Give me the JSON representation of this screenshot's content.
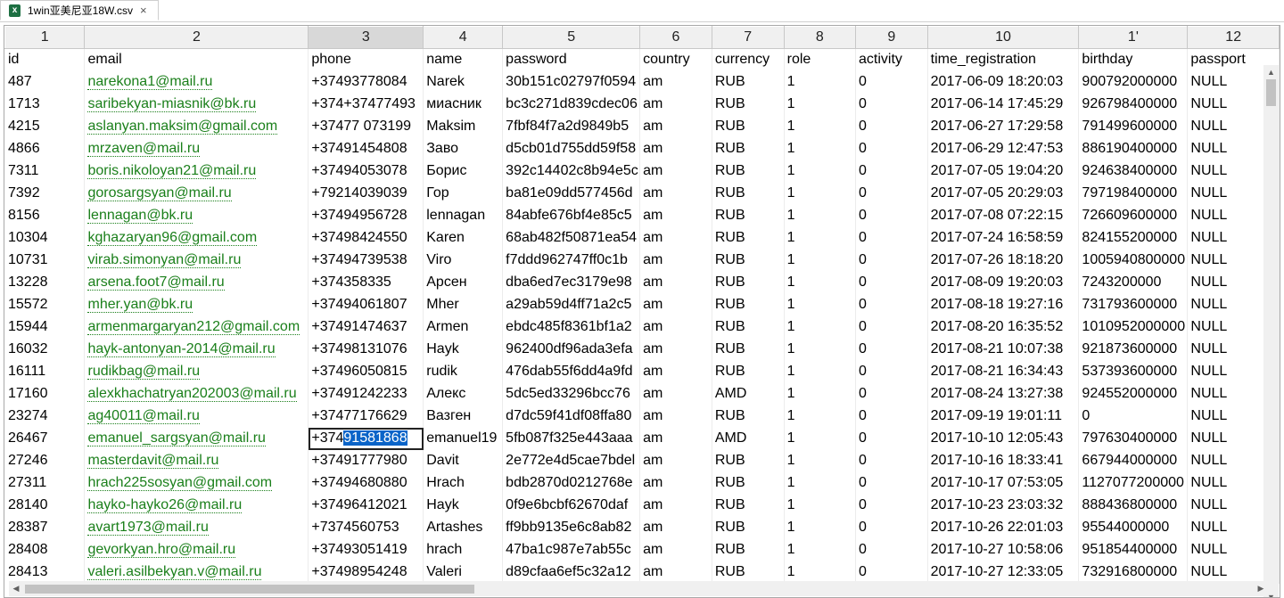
{
  "tab": {
    "title": "1win亚美尼亚18W.csv",
    "icon": "excel-file-icon",
    "close": "×"
  },
  "columns": [
    "1",
    "2",
    "3",
    "4",
    "5",
    "6",
    "7",
    "8",
    "9",
    "10",
    "1'",
    "12"
  ],
  "selected_column": 2,
  "header_row": [
    "id",
    "email",
    "phone",
    "name",
    "password",
    "country",
    "currency",
    "role",
    "activity",
    "time_registration",
    "birthday",
    "passport"
  ],
  "rows": [
    [
      "487",
      "narekona1@mail.ru",
      "+37493778084",
      "Narek",
      "30b151c02797f0594",
      "am",
      "RUB",
      "1",
      "0",
      "2017-06-09 18:20:03",
      "900792000000",
      "NULL"
    ],
    [
      "1713",
      "saribekyan-miasnik@bk.ru",
      "+374+37477493",
      "миасник",
      "bc3c271d839cdec06",
      "am",
      "RUB",
      "1",
      "0",
      "2017-06-14 17:45:29",
      "926798400000",
      "NULL"
    ],
    [
      "4215",
      "aslanyan.maksim@gmail.com",
      "+37477 073199",
      "Maksim",
      "7fbf84f7a2d9849b5",
      "am",
      "RUB",
      "1",
      "0",
      "2017-06-27 17:29:58",
      "791499600000",
      "NULL"
    ],
    [
      "4866",
      "mrzaven@mail.ru",
      "+37491454808",
      "Заво",
      "d5cb01d755dd59f58",
      "am",
      "RUB",
      "1",
      "0",
      "2017-06-29 12:47:53",
      "886190400000",
      "NULL"
    ],
    [
      "7311",
      "boris.nikoloyan21@mail.ru",
      "+37494053078",
      "Борис",
      "392c14402c8b94e5c",
      "am",
      "RUB",
      "1",
      "0",
      "2017-07-05 19:04:20",
      "924638400000",
      "NULL"
    ],
    [
      "7392",
      "gorosargsyan@mail.ru",
      "+79214039039",
      "Гор",
      "ba81e09dd577456d",
      "am",
      "RUB",
      "1",
      "0",
      "2017-07-05 20:29:03",
      "797198400000",
      "NULL"
    ],
    [
      "8156",
      "lennagan@bk.ru",
      "+37494956728",
      "lennagan",
      "84abfe676bf4e85c5",
      "am",
      "RUB",
      "1",
      "0",
      "2017-07-08 07:22:15",
      "726609600000",
      "NULL"
    ],
    [
      "10304",
      "kghazaryan96@gmail.com",
      "+37498424550",
      "Karen",
      "68ab482f50871ea54",
      "am",
      "RUB",
      "1",
      "0",
      "2017-07-24 16:58:59",
      "824155200000",
      "NULL"
    ],
    [
      "10731",
      "virab.simonyan@mail.ru",
      "+37494739538",
      "Viro",
      "f7ddd962747ff0c1b",
      "am",
      "RUB",
      "1",
      "0",
      "2017-07-26 18:18:20",
      "1005940800000",
      "NULL"
    ],
    [
      "13228",
      "arsena.foot7@mail.ru",
      "+374358335",
      "Арсен",
      "dba6ed7ec3179e98",
      "am",
      "RUB",
      "1",
      "0",
      "2017-08-09 19:20:03",
      "7243200000",
      "NULL"
    ],
    [
      "15572",
      "mher.yan@bk.ru",
      "+37494061807",
      "Mher",
      "a29ab59d4ff71a2c5",
      "am",
      "RUB",
      "1",
      "0",
      "2017-08-18 19:27:16",
      "731793600000",
      "NULL"
    ],
    [
      "15944",
      "armenmargaryan212@gmail.com",
      "+37491474637",
      "Armen",
      "ebdc485f8361bf1a2",
      "am",
      "RUB",
      "1",
      "0",
      "2017-08-20 16:35:52",
      "1010952000000",
      "NULL"
    ],
    [
      "16032",
      "hayk-antonyan-2014@mail.ru",
      "+37498131076",
      "Hayk",
      "962400df96ada3efa",
      "am",
      "RUB",
      "1",
      "0",
      "2017-08-21 10:07:38",
      "921873600000",
      "NULL"
    ],
    [
      "16111",
      "rudikbag@mail.ru",
      "+37496050815",
      "rudik",
      "476dab55f6dd4a9fd",
      "am",
      "RUB",
      "1",
      "0",
      "2017-08-21 16:34:43",
      "537393600000",
      "NULL"
    ],
    [
      "17160",
      "alexkhachatryan202003@mail.ru",
      "+37491242233",
      "Алекс",
      "5dc5ed33296bcc76",
      "am",
      "AMD",
      "1",
      "0",
      "2017-08-24 13:27:38",
      "924552000000",
      "NULL"
    ],
    [
      "23274",
      "ag40011@mail.ru",
      "+37477176629",
      "Вазген",
      "d7dc59f41df08ffa80",
      "am",
      "RUB",
      "1",
      "0",
      "2017-09-19 19:01:11",
      "0",
      "NULL"
    ],
    [
      "26467",
      "emanuel_sargsyan@mail.ru",
      "+37491581868",
      "emanuel19",
      "5fb087f325e443aaa",
      "am",
      "AMD",
      "1",
      "0",
      "2017-10-10 12:05:43",
      "797630400000",
      "NULL"
    ],
    [
      "27246",
      "masterdavit@mail.ru",
      "+37491777980",
      "Davit",
      "2e772e4d5cae7bdel",
      "am",
      "RUB",
      "1",
      "0",
      "2017-10-16 18:33:41",
      "667944000000",
      "NULL"
    ],
    [
      "27311",
      "hrach225sosyan@gmail.com",
      "+37494680880",
      "Hrach",
      "bdb2870d0212768e",
      "am",
      "RUB",
      "1",
      "0",
      "2017-10-17 07:53:05",
      "1127077200000",
      "NULL"
    ],
    [
      "28140",
      "hayko-hayko26@mail.ru",
      "+37496412021",
      "Hayk",
      "0f9e6bcbf62670daf",
      "am",
      "RUB",
      "1",
      "0",
      "2017-10-23 23:03:32",
      "888436800000",
      "NULL"
    ],
    [
      "28387",
      "avart1973@mail.ru",
      "+7374560753",
      "Artashes",
      "ff9bb9135e6c8ab82",
      "am",
      "RUB",
      "1",
      "0",
      "2017-10-26 22:01:03",
      "95544000000",
      "NULL"
    ],
    [
      "28408",
      "gevorkyan.hro@mail.ru",
      "+37493051419",
      "hrach",
      "47ba1c987e7ab55c",
      "am",
      "RUB",
      "1",
      "0",
      "2017-10-27 10:58:06",
      "951854400000",
      "NULL"
    ],
    [
      "28413",
      "valeri.asilbekyan.v@mail.ru",
      "+37498954248",
      "Valeri",
      "d89cfaa6ef5c32a12",
      "am",
      "RUB",
      "1",
      "0",
      "2017-10-27 12:33:05",
      "732916800000",
      "NULL"
    ]
  ],
  "active_cell": {
    "row": 16,
    "col": 2,
    "prefix": "+374",
    "selected_text": "91581868"
  },
  "colors": {
    "email_link": "#1a7f1a",
    "selection": "#0a64c8",
    "header_bg": "#f0f0f0"
  }
}
